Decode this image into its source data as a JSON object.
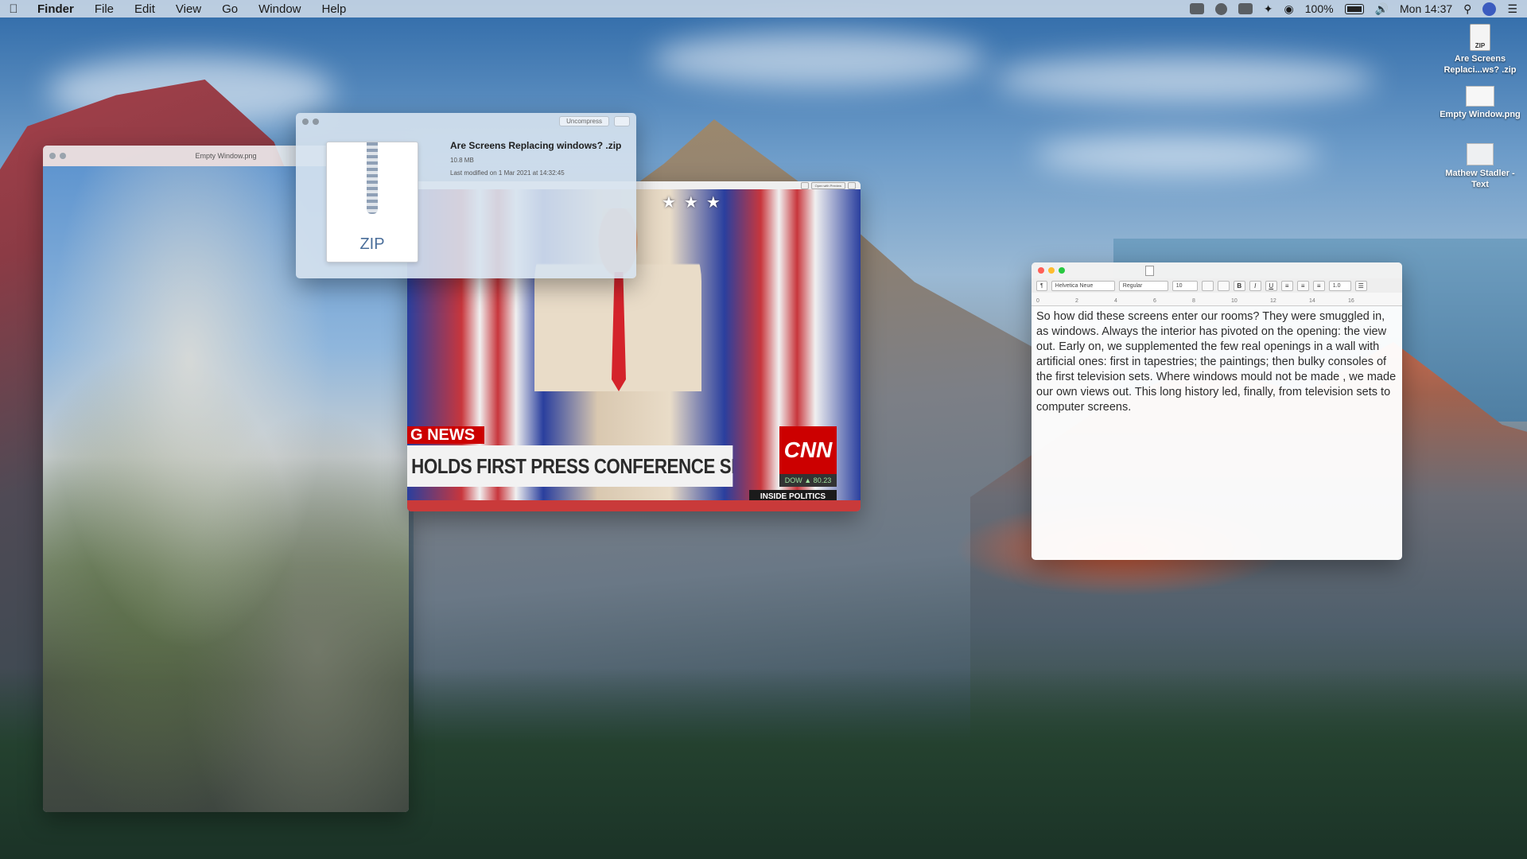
{
  "menubar": {
    "apple_icon": "apple-icon",
    "app_name": "Finder",
    "items": [
      "File",
      "Edit",
      "View",
      "Go",
      "Window",
      "Help"
    ],
    "battery": "100%",
    "clock": "Mon 14:37",
    "status_icons": [
      "dropbox-icon",
      "cloud-icon",
      "drive-icon",
      "bluetooth-icon",
      "wifi-icon",
      "battery-icon",
      "volume-icon",
      "search-icon",
      "user-avatar",
      "notification-icon"
    ]
  },
  "desktop_icons": [
    {
      "type": "zip",
      "label": "Are Screens Replaci...ws? .zip",
      "badge": "ZIP"
    },
    {
      "type": "png",
      "label": "Empty Window.png"
    },
    {
      "type": "text",
      "label": "Mathew Stadler - Text"
    }
  ],
  "preview_window": {
    "title": "Empty Window.png"
  },
  "zip_window": {
    "uncompress_label": "Uncompress",
    "file_badge": "ZIP",
    "file_name": "Are Screens Replacing windows? .zip",
    "file_size": "10.8 MB",
    "modified": "Last modified on 1 Mar 2021 at 14:32:45"
  },
  "video_window": {
    "open_with_label": "Open with Preview",
    "breaking": "G NEWS",
    "headline": "HOLDS FIRST PRESS CONFERENCE SINCE ELECTION",
    "network": "CNN",
    "ticker": "DOW ▲ 80.23",
    "show": "INSIDE POLITICS"
  },
  "text_window": {
    "toolbar": {
      "paragraph": "¶",
      "font": "Helvetica Neue",
      "style": "Regular",
      "size": "10",
      "bold": "B",
      "italic": "I",
      "underline": "U",
      "spacing": "1.0"
    },
    "ruler_marks": [
      "0",
      "2",
      "4",
      "6",
      "8",
      "10",
      "12",
      "14",
      "16"
    ],
    "body": "So how did these screens enter our rooms? They were smuggled in, as windows. Always the interior has pivoted on the opening: the view out. Early on, we supplemented the few real openings in a wall with artificial ones: first in tapestries; the paintings;  then bulky consoles of the first television sets. Where windows mould not be made , we made our own views out. This long history led, finally, from television sets to computer screens."
  }
}
